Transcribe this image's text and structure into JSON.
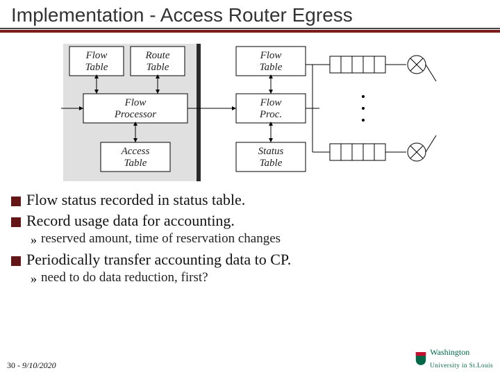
{
  "title": "Implementation - Access Router Egress",
  "diagram": {
    "boxes": {
      "flow_table_1a": "Flow",
      "flow_table_1b": "Table",
      "route_table_a": "Route",
      "route_table_b": "Table",
      "flow_table_2a": "Flow",
      "flow_table_2b": "Table",
      "flow_processor_a": "Flow",
      "flow_processor_b": "Processor",
      "flow_proc_a": "Flow",
      "flow_proc_b": "Proc.",
      "access_table_a": "Access",
      "access_table_b": "Table",
      "status_table_a": "Status",
      "status_table_b": "Table"
    }
  },
  "bullets": [
    "Flow status recorded in status table.",
    "Record usage data for accounting."
  ],
  "subbullets1": [
    "reserved amount, time of reservation changes"
  ],
  "bullet3": "Periodically transfer accounting data to CP.",
  "subbullets2": [
    "need to do data reduction, first?"
  ],
  "footer": {
    "page": "30",
    "sep": "-",
    "date": "9/10/2020",
    "logo_main": "Washington",
    "logo_sub": "University in St.Louis"
  }
}
